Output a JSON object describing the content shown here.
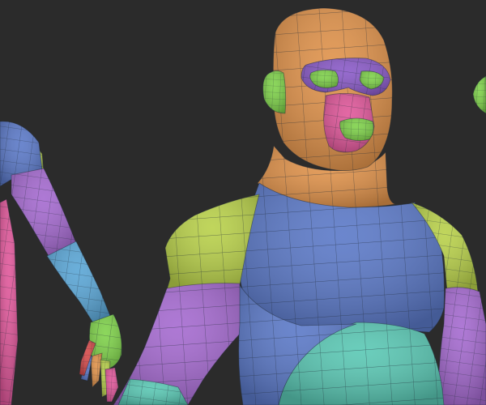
{
  "scene": {
    "background": "#2b2b2b",
    "wire_color": "#1f2a36",
    "polygroup_colors": {
      "orange": "#e0924a",
      "orange_dark": "#c97a3a",
      "purple": "#8a5ac8",
      "violet": "#a56ad0",
      "lime": "#b9d14a",
      "green": "#7fd24a",
      "pink": "#e0579a",
      "blue": "#5b79c8",
      "sky": "#5aa6d6",
      "teal": "#5ac8b4",
      "red": "#d64a4a"
    }
  }
}
